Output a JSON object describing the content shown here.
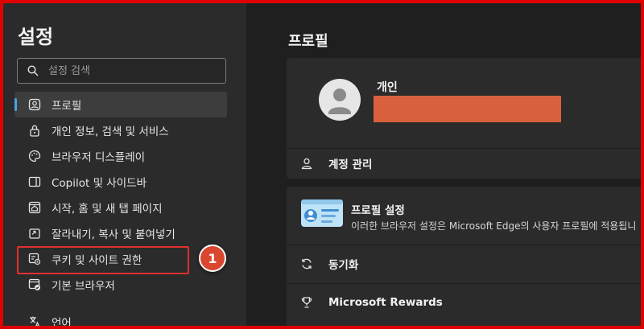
{
  "sidebar": {
    "title": "설정",
    "search": {
      "placeholder": "설정 검색",
      "icon": "search-icon"
    },
    "items": [
      {
        "label": "프로필",
        "icon": "profile-icon",
        "active": true
      },
      {
        "label": "개인 정보, 검색 및 서비스",
        "icon": "lock-icon"
      },
      {
        "label": "브라우저 디스플레이",
        "icon": "palette-icon"
      },
      {
        "label": "Copilot 및 사이드바",
        "icon": "sidebar-icon"
      },
      {
        "label": "시작, 홈 및 새 탭 페이지",
        "icon": "home-tab-icon"
      },
      {
        "label": "잘라내기, 복사 및 붙여넣기",
        "icon": "clipboard-icon"
      },
      {
        "label": "쿠키 및 사이트 권한",
        "icon": "cookie-permissions-icon"
      },
      {
        "label": "기본 브라우저",
        "icon": "default-browser-icon"
      },
      {
        "label": "언어",
        "icon": "language-icon"
      }
    ],
    "annotation": {
      "step": "1",
      "color": "#d9472e"
    }
  },
  "main": {
    "title": "프로필",
    "profile_card": {
      "name": "개인",
      "redaction_color": "#d9603f",
      "account_manage": "계정 관리"
    },
    "settings_card": {
      "profile_settings_title": "프로필 설정",
      "profile_settings_desc": "이러한 브라우저 설정은 Microsoft Edge의 사용자 프로필에 적용됩니",
      "sync_label": "동기화",
      "rewards_label": "Microsoft Rewards"
    }
  },
  "colors": {
    "frame": "#e00000",
    "accent": "#4aa3e8",
    "highlight": "#e03030"
  }
}
